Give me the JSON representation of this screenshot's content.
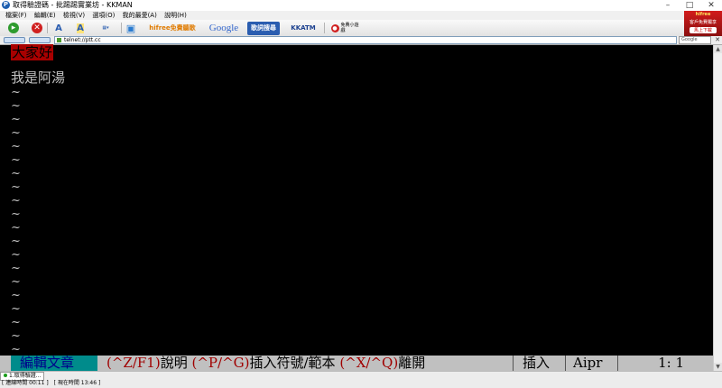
{
  "window": {
    "title": "取得驗證碼 - 批踢踢實業坊 - KKMAN",
    "app_icon": "P",
    "controls": {
      "minimize": "–",
      "maximize": "□",
      "close": "✕"
    }
  },
  "menu": [
    "檔案(F)",
    "編輯(E)",
    "檢視(V)",
    "選項(O)",
    "我的最愛(A)",
    "說明(H)"
  ],
  "toolbar": {
    "hifree_label": "hifree免費聽歌",
    "google_label": "Google",
    "song_search_label": "歌詞搜尋",
    "kkatm_label": "KKATM",
    "games_label": "免費小遊戲"
  },
  "ad": {
    "line1": "hifree",
    "line2": "客戶免費獨享",
    "button": "馬上下載"
  },
  "address": {
    "url": "telnet://ptt.cc",
    "search_label": "Google"
  },
  "terminal": {
    "greeting": "大家好",
    "line2": "我是阿湯",
    "tilde": "~",
    "status": {
      "mode": "編輯文章",
      "help_1_key": "(^Z/F1)",
      "help_1_text": "說明",
      "help_2_key": "(^P/^G)",
      "help_2_text": "插入符號/範本",
      "help_3_key": "(^X/^Q)",
      "help_3_text": "離開",
      "insert_mode": "插入",
      "ime": "Aipr",
      "position": "1:   1"
    }
  },
  "bottom": {
    "connection_tab": "1.取得驗證...",
    "connect_time": "[ 連線時間 00:11 ]",
    "current_time": "[ 現在時間 13:46 ]"
  },
  "colors": {
    "highlight": "#a80000",
    "status_mode_bg": "#008b8b",
    "status_bar_bg": "#c0c0c0"
  }
}
